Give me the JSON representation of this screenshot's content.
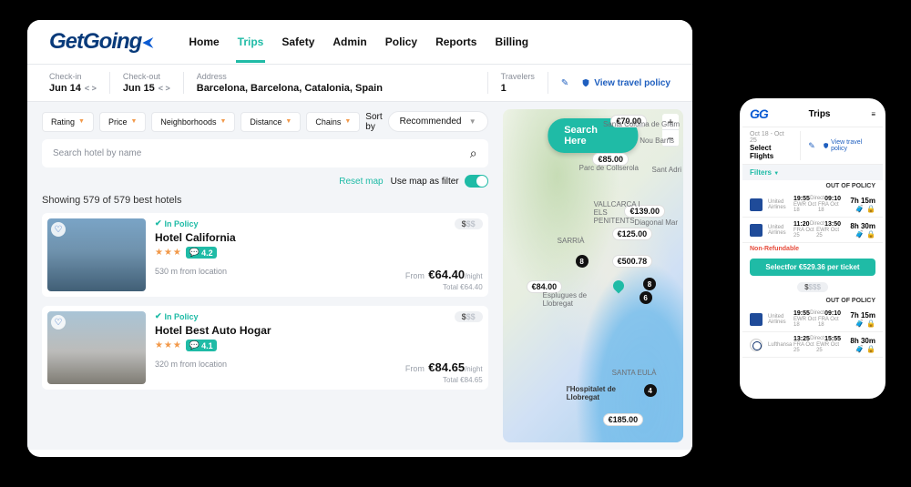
{
  "logo": "GetGoing",
  "nav": [
    "Home",
    "Trips",
    "Safety",
    "Admin",
    "Policy",
    "Reports",
    "Billing"
  ],
  "active_nav": "Trips",
  "searchbar": {
    "checkin_label": "Check-in",
    "checkin": "Jun 14",
    "checkout_label": "Check-out",
    "checkout": "Jun 15",
    "address_label": "Address",
    "address": "Barcelona, Barcelona, Catalonia, Spain",
    "travelers_label": "Travelers",
    "travelers": "1",
    "policy_link": "View travel policy"
  },
  "filters": [
    "Rating",
    "Price",
    "Neighborhoods",
    "Distance",
    "Chains"
  ],
  "sort": {
    "label": "Sort by",
    "value": "Recommended"
  },
  "hotel_search_placeholder": "Search hotel by name",
  "map_controls": {
    "reset": "Reset map",
    "use_as_filter": "Use map as filter"
  },
  "showing": "Showing 579 of 579 best hotels",
  "hotels": [
    {
      "policy": "In Policy",
      "name": "Hotel California",
      "stars": "★★★",
      "rating": "4.2",
      "distance": "530 m from location",
      "from_label": "From",
      "price": "€64.40",
      "per": "/night",
      "total": "Total €64.40",
      "tier": "$",
      "tier_full": "$$$"
    },
    {
      "policy": "In Policy",
      "name": "Hotel Best Auto Hogar",
      "stars": "★★★",
      "rating": "4.1",
      "distance": "320 m from location",
      "from_label": "From",
      "price": "€84.65",
      "per": "/night",
      "total": "Total €84.65",
      "tier": "$",
      "tier_full": "$$$"
    }
  ],
  "map": {
    "search_here": "Search Here",
    "pins": [
      "€70.00",
      "€85.00",
      "€139.00",
      "€125.00",
      "€500.78",
      "€84.00",
      "€185.00"
    ],
    "dots": [
      "8",
      "6",
      "4",
      "8"
    ],
    "labels": [
      "Santa Coloma de Gram",
      "Nou Barris",
      "Sant Adri",
      "Parc de Collserola",
      "VALLCARCA I ELS PENITENTS",
      "SARRIÀ",
      "Diagonal Mar",
      "Esplugues de Llobregat",
      "l'Hospitalet de Llobregat",
      "SANTA EULÀ"
    ]
  },
  "mobile": {
    "logo": "GG",
    "title": "Trips",
    "dates": "Oct 18 - Oct 25",
    "select": "Select Flights",
    "policy": "View travel policy",
    "filters": "Filters",
    "out_of_policy": "OUT OF POLICY",
    "non_refundable": "Non-Refundable",
    "select_btn": "Selectfor €529.36 per ticket",
    "flights": [
      {
        "airline": "United Airlines",
        "dep": "19:55",
        "dep_code": "EWR",
        "dep_date": "Oct 18",
        "line": "Direct",
        "arr": "09:10",
        "arr_code": "FRA",
        "arr_date": "Oct 18",
        "dur": "7h 15m"
      },
      {
        "airline": "United Airlines",
        "dep": "11:20",
        "dep_code": "FRA",
        "dep_date": "Oct 25",
        "line": "Direct",
        "arr": "13:50",
        "arr_code": "EWR",
        "arr_date": "Oct 25",
        "dur": "8h 30m"
      },
      {
        "airline": "United Airlines",
        "dep": "19:55",
        "dep_code": "EWR",
        "dep_date": "Oct 18",
        "line": "Direct",
        "arr": "09:10",
        "arr_code": "FRA",
        "arr_date": "Oct 18",
        "dur": "7h 15m"
      },
      {
        "airline": "Lufthansa",
        "dep": "13:25",
        "dep_code": "FRA",
        "dep_date": "Oct 25",
        "line": "Direct",
        "arr": "15:55",
        "arr_code": "EWR",
        "arr_date": "Oct 25",
        "dur": "8h 30m"
      }
    ],
    "tier_full": "$$$$"
  }
}
